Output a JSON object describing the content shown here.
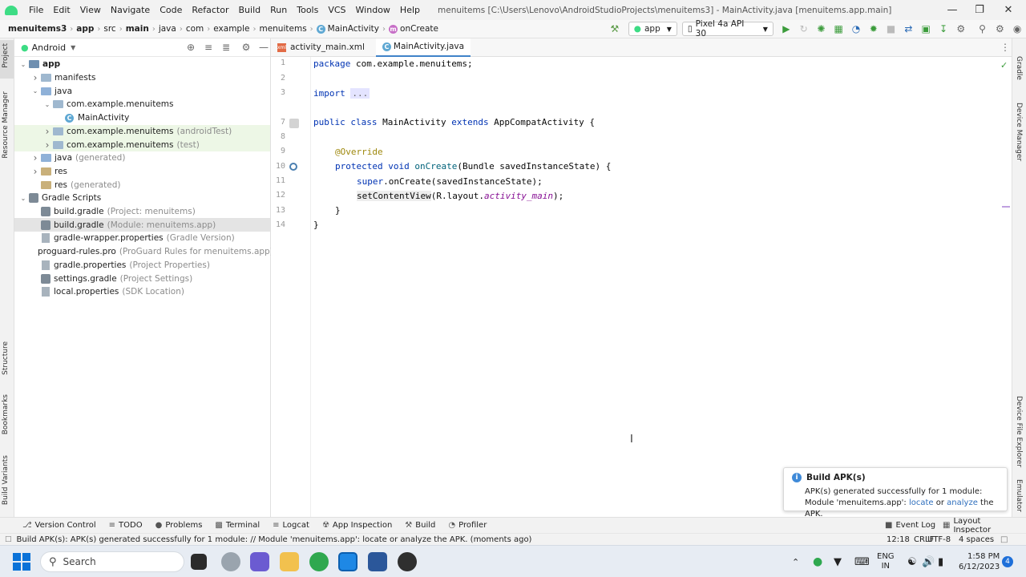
{
  "menubar": {
    "items": [
      "File",
      "Edit",
      "View",
      "Navigate",
      "Code",
      "Refactor",
      "Build",
      "Run",
      "Tools",
      "VCS",
      "Window",
      "Help"
    ],
    "window_title": "menuitems [C:\\Users\\Lenovo\\AndroidStudioProjects\\menuitems3] - MainActivity.java [menuitems.app.main]"
  },
  "navbar": {
    "breadcrumbs": [
      "menuitems3",
      "app",
      "src",
      "main",
      "java",
      "com",
      "example",
      "menuitems",
      "MainActivity",
      "onCreate"
    ],
    "run_config": "app",
    "device": "Pixel 4a API 30"
  },
  "project": {
    "view_mode": "Android",
    "tree": [
      {
        "label": "app",
        "hint": "",
        "depth": 0,
        "expanded": true,
        "icon": "module-folder"
      },
      {
        "label": "manifests",
        "hint": "",
        "depth": 1,
        "expanded": false,
        "icon": "folder"
      },
      {
        "label": "java",
        "hint": "",
        "depth": 1,
        "expanded": true,
        "icon": "folder"
      },
      {
        "label": "com.example.menuitems",
        "hint": "",
        "depth": 2,
        "expanded": true,
        "icon": "package"
      },
      {
        "label": "MainActivity",
        "hint": "",
        "depth": 3,
        "expanded": null,
        "icon": "class"
      },
      {
        "label": "com.example.menuitems",
        "hint": "(androidTest)",
        "depth": 2,
        "expanded": false,
        "icon": "package"
      },
      {
        "label": "com.example.menuitems",
        "hint": "(test)",
        "depth": 2,
        "expanded": false,
        "icon": "package"
      },
      {
        "label": "java",
        "hint": "(generated)",
        "depth": 1,
        "expanded": false,
        "icon": "folder"
      },
      {
        "label": "res",
        "hint": "",
        "depth": 1,
        "expanded": false,
        "icon": "folder"
      },
      {
        "label": "res",
        "hint": "(generated)",
        "depth": 1,
        "expanded": null,
        "icon": "folder"
      },
      {
        "label": "Gradle Scripts",
        "hint": "",
        "depth": 0,
        "expanded": true,
        "icon": "gradle"
      },
      {
        "label": "build.gradle",
        "hint": "(Project: menuitems)",
        "depth": 1,
        "expanded": null,
        "icon": "gradle"
      },
      {
        "label": "build.gradle",
        "hint": "(Module: menuitems.app)",
        "depth": 1,
        "expanded": null,
        "icon": "gradle"
      },
      {
        "label": "gradle-wrapper.properties",
        "hint": "(Gradle Version)",
        "depth": 1,
        "expanded": null,
        "icon": "file"
      },
      {
        "label": "proguard-rules.pro",
        "hint": "(ProGuard Rules for menuitems.app)",
        "depth": 1,
        "expanded": null,
        "icon": "file"
      },
      {
        "label": "gradle.properties",
        "hint": "(Project Properties)",
        "depth": 1,
        "expanded": null,
        "icon": "file"
      },
      {
        "label": "settings.gradle",
        "hint": "(Project Settings)",
        "depth": 1,
        "expanded": null,
        "icon": "gradle"
      },
      {
        "label": "local.properties",
        "hint": "(SDK Location)",
        "depth": 1,
        "expanded": null,
        "icon": "file"
      }
    ]
  },
  "editor": {
    "tabs": [
      {
        "label": "activity_main.xml",
        "active": false
      },
      {
        "label": "MainActivity.java",
        "active": true
      }
    ],
    "line_numbers": [
      "1",
      "2",
      "3",
      "7",
      "8",
      "9",
      "10",
      "11",
      "12",
      "13",
      "14"
    ],
    "code": {
      "l1_kw": "package",
      "l1_rest": " com.example.menuitems;",
      "l3_kw": "import",
      "l3_fold": "...",
      "l7_kw1": "public class",
      "l7_a": " MainActivity ",
      "l7_kw2": "extends",
      "l7_b": " AppCompatActivity {",
      "l9_ann": "@Override",
      "l10_kw": "protected void",
      "l10_fn": " onCreate",
      "l10_rest": "(Bundle savedInstanceState) {",
      "l11_kw": "super",
      "l11_rest": ".onCreate(savedInstanceState);",
      "l12_a": "setContentView",
      "l12_b": "(R.layout.",
      "l12_it": "activity_main",
      "l12_c": ");",
      "l13": "}",
      "l14": "}"
    }
  },
  "notification": {
    "title": "Build APK(s)",
    "line1": "APK(s) generated successfully for 1 module:",
    "line2_prefix": "Module 'menuitems.app': ",
    "link1": "locate",
    "or": " or ",
    "link2": "analyze",
    "suffix": " the APK."
  },
  "side_tabs": {
    "left": [
      "Project",
      "Resource Manager",
      "Structure",
      "Bookmarks",
      "Build Variants"
    ],
    "right": [
      "Gradle",
      "Device Manager",
      "Device File Explorer",
      "Emulator"
    ]
  },
  "bottom_tools": {
    "left": [
      "Version Control",
      "TODO",
      "Problems",
      "Terminal",
      "Logcat",
      "App Inspection",
      "Build",
      "Profiler"
    ],
    "right": [
      "Event Log",
      "Layout Inspector"
    ]
  },
  "statusbar": {
    "message": "Build APK(s): APK(s) generated successfully for 1 module: // Module 'menuitems.app': locate or analyze the APK. (moments ago)",
    "position": "12:18",
    "line_sep": "CRLF",
    "encoding": "UTF-8",
    "indent": "4 spaces"
  },
  "taskbar": {
    "search_label": "Search",
    "lang_line1": "ENG",
    "lang_line2": "IN",
    "time": "1:58 PM",
    "date": "6/12/2023",
    "notif_count": "4"
  },
  "colors": {
    "accent": "#4083c9",
    "android_green": "#3ddc84",
    "selection": "#e4e4e4"
  }
}
